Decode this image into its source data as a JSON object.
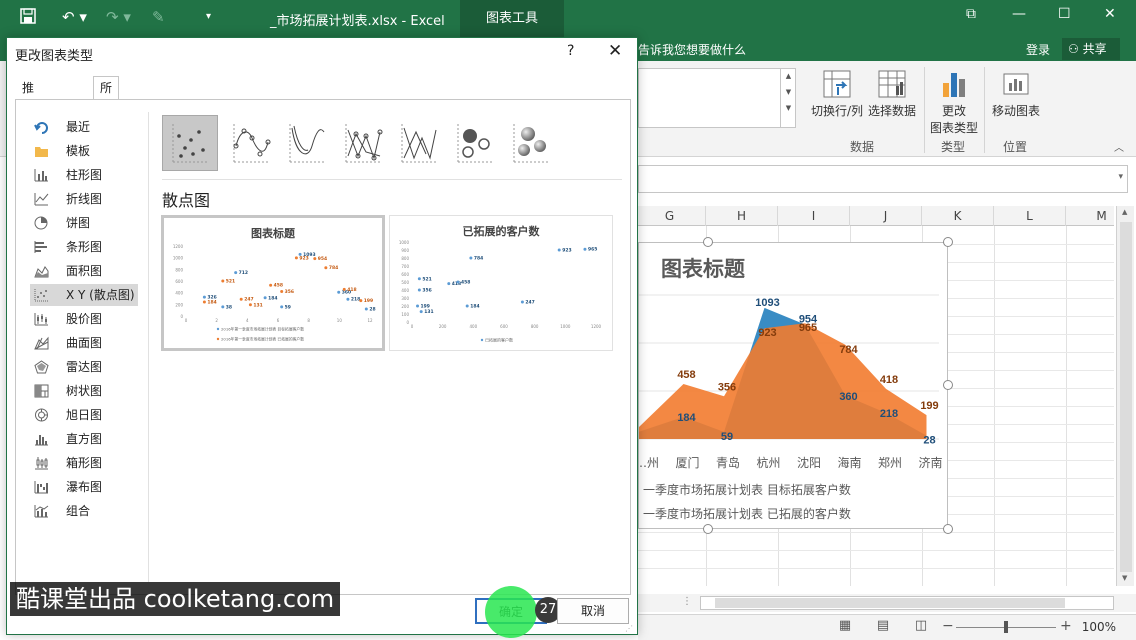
{
  "window": {
    "title": "_市场拓展计划表.xlsx - Excel",
    "context_tab": "图表工具"
  },
  "ribbon": {
    "tell_me": "告诉我您想要做什么",
    "login": "登录",
    "share": "共享",
    "buttons": {
      "switch_row_col": "切换行/列",
      "select_data": "选择数据",
      "change_type_1": "更改",
      "change_type_2": "图表类型",
      "move_chart": "移动图表"
    },
    "groups": {
      "data": "数据",
      "type": "类型",
      "location": "位置"
    }
  },
  "sheet": {
    "columns": [
      "G",
      "H",
      "I",
      "J",
      "K",
      "L",
      "M"
    ]
  },
  "chart": {
    "title": "图表标题",
    "legend": [
      "一季度市场拓展计划表 目标拓展客户数",
      "一季度市场拓展计划表 已拓展的客户数"
    ],
    "colors": {
      "target": "#2e86c1",
      "actual": "#f27b2f"
    }
  },
  "chart_data": {
    "type": "area",
    "title": "图表标题",
    "categories": [
      "…州",
      "厦门",
      "青岛",
      "杭州",
      "沈阳",
      "海南",
      "郑州",
      "济南"
    ],
    "series": [
      {
        "name": "一季度市场拓展计划表 目标拓展客户数",
        "values": [
          null,
          184,
          59,
          1093,
          954,
          360,
          218,
          28
        ]
      },
      {
        "name": "一季度市场拓展计划表 已拓展的客户数",
        "values": [
          null,
          458,
          356,
          923,
          965,
          784,
          418,
          199
        ]
      }
    ]
  },
  "statusbar": {
    "zoom": "100%"
  },
  "dialog": {
    "title": "更改图表类型",
    "help": "?",
    "close": "✕",
    "tabs": {
      "recommended": "推荐的图表",
      "all": "所有图表"
    },
    "nav": [
      "最近",
      "模板",
      "柱形图",
      "折线图",
      "饼图",
      "条形图",
      "面积图",
      "X Y (散点图)",
      "股价图",
      "曲面图",
      "雷达图",
      "树状图",
      "旭日图",
      "直方图",
      "箱形图",
      "瀑布图",
      "组合"
    ],
    "subtype_heading": "散点图",
    "preview1": {
      "title": "图表标题",
      "legend1": "2016年第一季度市场拓展计划表 目标拓展客户数",
      "legend2": "2016年第一季度市场拓展计划表 已拓展的客户数",
      "yticks": [
        "1200",
        "1000",
        "800",
        "600",
        "400",
        "200",
        "0"
      ],
      "xticks": [
        "0",
        "2",
        "4",
        "6",
        "8",
        "10",
        "12"
      ],
      "labels_a": [
        "326",
        "712",
        "184",
        "59",
        "1093",
        "360",
        "218",
        "28",
        "38"
      ],
      "labels_b": [
        "184",
        "521",
        "247",
        "458",
        "356",
        "923",
        "954",
        "784",
        "418",
        "199",
        "131"
      ]
    },
    "preview2": {
      "title": "已拓展的客户数",
      "legend": "已拓展的客户数",
      "yticks": [
        "1000",
        "900",
        "800",
        "700",
        "600",
        "500",
        "400",
        "300",
        "200",
        "100",
        "0"
      ],
      "xticks": [
        "0",
        "200",
        "400",
        "600",
        "800",
        "1000",
        "1200"
      ],
      "labels": [
        "521",
        "356",
        "418",
        "458",
        "184",
        "199",
        "131",
        "784",
        "247",
        "923",
        "965"
      ]
    },
    "ok": "确定",
    "cancel": "取消",
    "step": "27"
  },
  "watermark": "酷课堂出品 coolketang.com"
}
